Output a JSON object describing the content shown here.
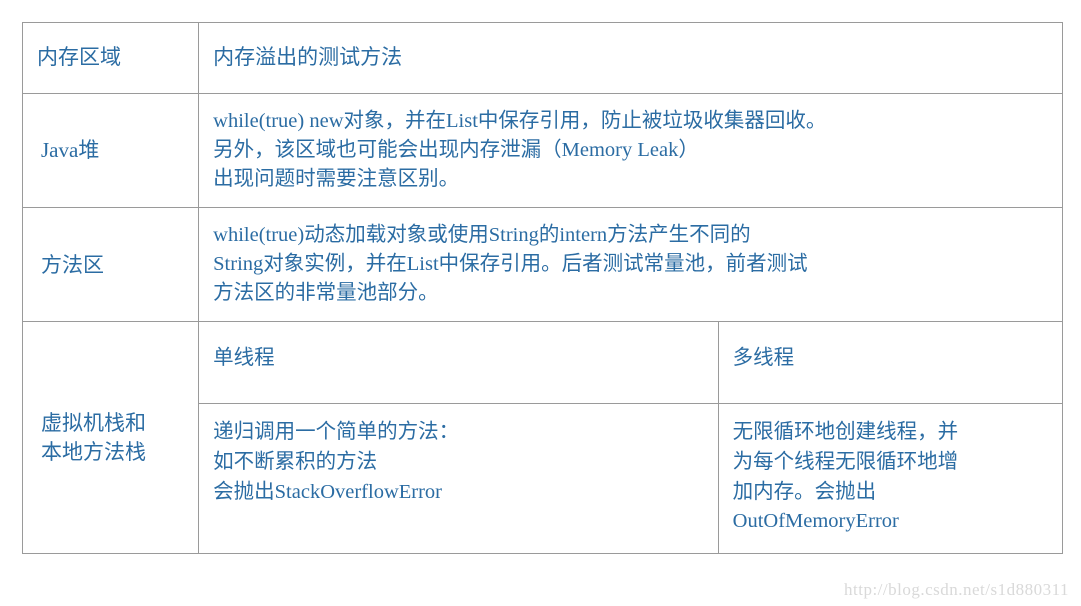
{
  "table": {
    "headers": {
      "memory_area": "内存区域",
      "test_method": "内存溢出的测试方法"
    },
    "rows": [
      {
        "area": "Java堆",
        "method": "while(true) new对象，并在List中保存引用，防止被垃圾收集器回收。\n另外，该区域也可能会出现内存泄漏（Memory Leak）\n出现问题时需要注意区别。"
      },
      {
        "area": "方法区",
        "method": "while(true)动态加载对象或使用String的intern方法产生不同的\nString对象实例，并在List中保存引用。后者测试常量池，前者测试\n方法区的非常量池部分。"
      },
      {
        "area": "虚拟机栈和\n本地方法栈",
        "thread_table": {
          "single_thread_header": "单线程",
          "multi_thread_header": "多线程",
          "single_thread_body": "递归调用一个简单的方法：\n如不断累积的方法\n会抛出StackOverflowError",
          "multi_thread_body": "无限循环地创建线程，并\n为每个线程无限循环地增\n加内存。会抛出\nOutOfMemoryError"
        }
      }
    ]
  },
  "watermark": {
    "text": "http://blog.csdn.net/s1d880311"
  },
  "colors": {
    "text": "#2b6ca3",
    "border": "#9a9a9a",
    "background": "#ffffff",
    "watermark": "#d9d9d9"
  }
}
